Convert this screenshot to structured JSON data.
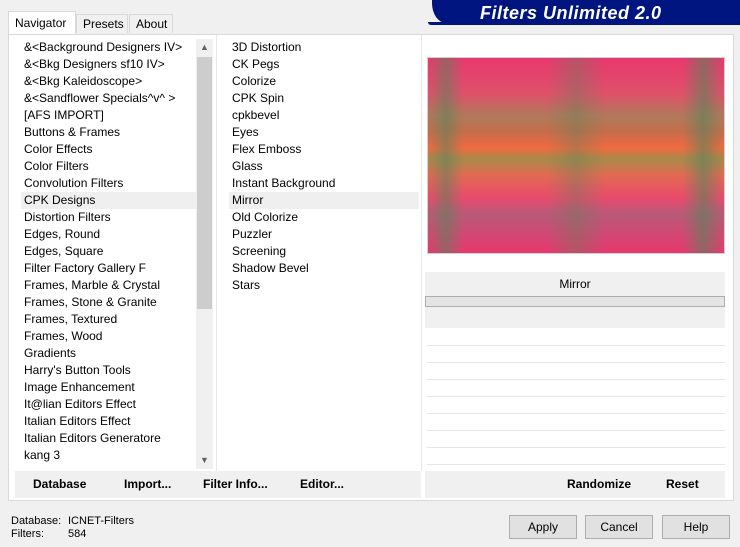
{
  "tabs": [
    "Navigator",
    "Presets",
    "About"
  ],
  "banner_title": "Filters Unlimited 2.0",
  "categories": [
    "&<Background Designers IV>",
    "&<Bkg Designers sf10 IV>",
    "&<Bkg Kaleidoscope>",
    "&<Sandflower Specials^v^ >",
    "[AFS IMPORT]",
    "Buttons & Frames",
    "Color Effects",
    "Color Filters",
    "Convolution Filters",
    "CPK Designs",
    "Distortion Filters",
    "Edges, Round",
    "Edges, Square",
    "Filter Factory Gallery F",
    "Frames, Marble & Crystal",
    "Frames, Stone & Granite",
    "Frames, Textured",
    "Frames, Wood",
    "Gradients",
    "Harry's Button Tools",
    "Image Enhancement",
    "It@lian Editors Effect",
    "Italian Editors Effect",
    "Italian Editors Generatore",
    "kang 3"
  ],
  "selected_category": "CPK Designs",
  "filters": [
    "3D Distortion",
    "CK Pegs",
    "Colorize",
    "CPK Spin",
    "cpkbevel",
    "Eyes",
    "Flex Emboss",
    "Glass",
    "Instant Background",
    "Mirror",
    "Old Colorize",
    "Puzzler",
    "Screening",
    "Shadow Bevel",
    "Stars"
  ],
  "selected_filter": "Mirror",
  "param_header": "Mirror",
  "toolbar": {
    "database": "Database",
    "import": "Import...",
    "filter_info": "Filter Info...",
    "editor": "Editor...",
    "randomize": "Randomize",
    "reset": "Reset"
  },
  "status": {
    "database_label": "Database:",
    "database_value": "ICNET-Filters",
    "filters_label": "Filters:",
    "filters_value": "584"
  },
  "buttons": {
    "apply": "Apply",
    "cancel": "Cancel",
    "help": "Help"
  },
  "icons": {
    "scroll_up": "chevron-up-icon",
    "scroll_down": "chevron-down-icon"
  },
  "colors": {
    "banner": "#00157f"
  }
}
